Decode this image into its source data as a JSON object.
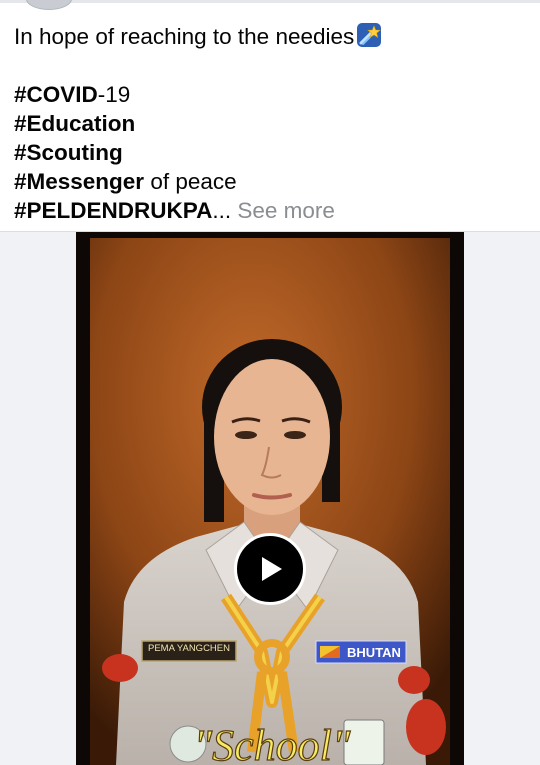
{
  "post": {
    "line1": "In hope of reaching to the needies",
    "line1_emoji": "shooting-star-emoji",
    "hashtags": [
      {
        "tag": "#COVID",
        "rest": "-19"
      },
      {
        "tag": "#Education",
        "rest": ""
      },
      {
        "tag": "#Scouting",
        "rest": ""
      },
      {
        "tag": "#Messenger",
        "rest": " of peace"
      },
      {
        "tag": "#PELDENDRUKPA",
        "rest": "..."
      }
    ],
    "see_more": "See more"
  },
  "video": {
    "name_tag": "PEMA YANGCHEN",
    "country_tag": "BHUTAN",
    "caption": "\"School\"",
    "play_icon": "play-icon"
  },
  "colors": {
    "text": "#050505",
    "see_more": "#8a8d91",
    "background": "#ffffff",
    "media_bg": "#f0f2f5"
  }
}
